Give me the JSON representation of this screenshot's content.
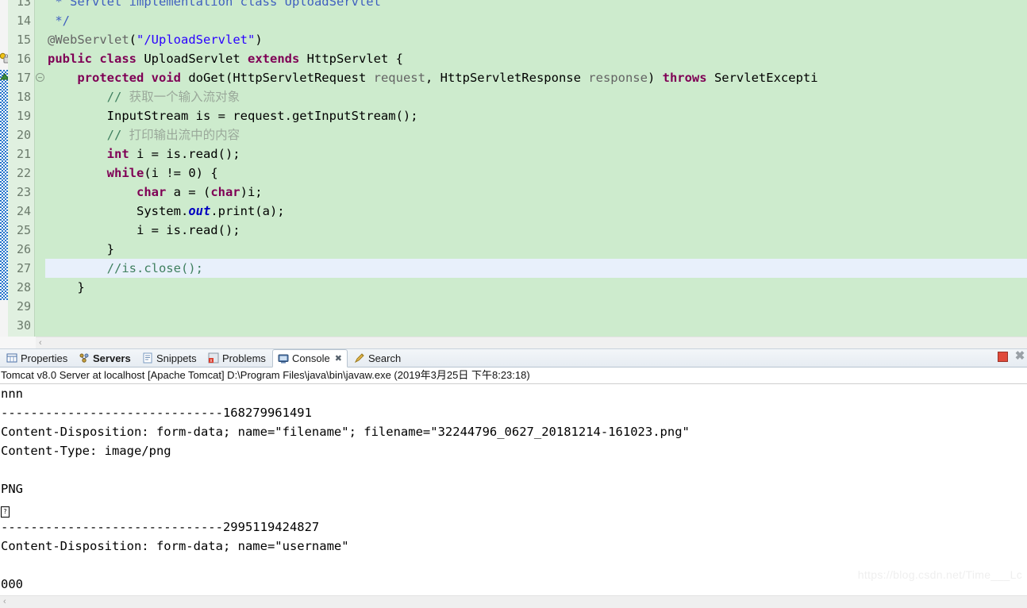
{
  "editor": {
    "first_visible_line": 13,
    "current_line": 27,
    "lines": [
      {
        "num": 13,
        "clipped_top": true,
        "tokens": [
          {
            "t": " * Servlet implementation class UploadServlet",
            "c": "jdoc"
          }
        ]
      },
      {
        "num": 14,
        "tokens": [
          {
            "t": " */",
            "c": "jdoc"
          }
        ]
      },
      {
        "num": 15,
        "tokens": [
          {
            "t": "@WebServlet",
            "c": "anno"
          },
          {
            "t": "(",
            "c": "plain"
          },
          {
            "t": "\"/UploadServlet\"",
            "c": "str"
          },
          {
            "t": ")",
            "c": "plain"
          }
        ]
      },
      {
        "num": 16,
        "gutter_icon": "warning-key-icon",
        "tokens": [
          {
            "t": "public",
            "c": "kw"
          },
          {
            "t": " ",
            "c": "plain"
          },
          {
            "t": "class",
            "c": "kw"
          },
          {
            "t": " UploadServlet ",
            "c": "plain"
          },
          {
            "t": "extends",
            "c": "kw"
          },
          {
            "t": " HttpServlet {",
            "c": "plain"
          }
        ]
      },
      {
        "num": 17,
        "fold": true,
        "gutter_icon": "collapse-triangle-icon",
        "tokens": [
          {
            "t": "    ",
            "c": "plain"
          },
          {
            "t": "protected",
            "c": "kw"
          },
          {
            "t": " ",
            "c": "plain"
          },
          {
            "t": "void",
            "c": "kw"
          },
          {
            "t": " doGet(HttpServletRequest ",
            "c": "plain"
          },
          {
            "t": "request",
            "c": "anno"
          },
          {
            "t": ", HttpServletResponse ",
            "c": "plain"
          },
          {
            "t": "response",
            "c": "anno"
          },
          {
            "t": ") ",
            "c": "plain"
          },
          {
            "t": "throws",
            "c": "kw"
          },
          {
            "t": " ServletExcepti",
            "c": "plain"
          }
        ]
      },
      {
        "num": 18,
        "tokens": [
          {
            "t": "        // ",
            "c": "cmt"
          },
          {
            "t": "获取一个输入流对象",
            "c": "cmt-cn"
          }
        ]
      },
      {
        "num": 19,
        "tokens": [
          {
            "t": "        InputStream is = request.getInputStream();",
            "c": "plain"
          }
        ]
      },
      {
        "num": 20,
        "tokens": [
          {
            "t": "        // ",
            "c": "cmt"
          },
          {
            "t": "打印输出流中的内容",
            "c": "cmt-cn"
          }
        ]
      },
      {
        "num": 21,
        "tokens": [
          {
            "t": "        ",
            "c": "plain"
          },
          {
            "t": "int",
            "c": "kw"
          },
          {
            "t": " i = is.read();",
            "c": "plain"
          }
        ]
      },
      {
        "num": 22,
        "tokens": [
          {
            "t": "        ",
            "c": "plain"
          },
          {
            "t": "while",
            "c": "kw"
          },
          {
            "t": "(i != 0) {",
            "c": "plain"
          }
        ]
      },
      {
        "num": 23,
        "tokens": [
          {
            "t": "            ",
            "c": "plain"
          },
          {
            "t": "char",
            "c": "kw"
          },
          {
            "t": " a = (",
            "c": "plain"
          },
          {
            "t": "char",
            "c": "kw"
          },
          {
            "t": ")i;",
            "c": "plain"
          }
        ]
      },
      {
        "num": 24,
        "tokens": [
          {
            "t": "            System.",
            "c": "plain"
          },
          {
            "t": "out",
            "c": "sfield"
          },
          {
            "t": ".print(a);",
            "c": "plain"
          }
        ]
      },
      {
        "num": 25,
        "tokens": [
          {
            "t": "            i = is.read();",
            "c": "plain"
          }
        ]
      },
      {
        "num": 26,
        "tokens": [
          {
            "t": "        }",
            "c": "plain"
          }
        ]
      },
      {
        "num": 27,
        "current": true,
        "tokens": [
          {
            "t": "        //is.close();",
            "c": "cmt"
          }
        ]
      },
      {
        "num": 28,
        "tokens": [
          {
            "t": "    }",
            "c": "plain"
          }
        ]
      },
      {
        "num": 29,
        "tokens": [
          {
            "t": "",
            "c": "plain"
          }
        ]
      },
      {
        "num": 30,
        "tokens": [
          {
            "t": "",
            "c": "plain"
          }
        ]
      }
    ]
  },
  "bottom_panel": {
    "tabs": [
      {
        "label": "Properties",
        "icon": "properties-icon",
        "active": false,
        "bold": false,
        "closeable": false
      },
      {
        "label": "Servers",
        "icon": "servers-icon",
        "active": false,
        "bold": true,
        "closeable": false
      },
      {
        "label": "Snippets",
        "icon": "snippets-icon",
        "active": false,
        "bold": false,
        "closeable": false
      },
      {
        "label": "Problems",
        "icon": "problems-icon",
        "active": false,
        "bold": false,
        "closeable": false
      },
      {
        "label": "Console",
        "icon": "console-icon",
        "active": true,
        "bold": false,
        "closeable": true
      },
      {
        "label": "Search",
        "icon": "search-icon",
        "active": false,
        "bold": false,
        "closeable": false
      }
    ],
    "close_glyph": "✖",
    "tools": [
      {
        "name": "terminate-button",
        "glyph": ""
      },
      {
        "name": "remove-launch-button",
        "glyph": "✖"
      }
    ],
    "console_header": "Tomcat v8.0 Server at localhost [Apache Tomcat] D:\\Program Files\\java\\bin\\javaw.exe (2019年3月25日 下午8:23:18)",
    "console_lines": [
      {
        "text": "nnn"
      },
      {
        "text": "------------------------------168279961491"
      },
      {
        "text": "Content-Disposition: form-data; name=\"filename\"; filename=\"32244796_0627_20181214-161023.png\""
      },
      {
        "text": "Content-Type: image/png"
      },
      {
        "text": ""
      },
      {
        "text": "PNG"
      },
      {
        "text": "",
        "glyph": "?"
      },
      {
        "text": "------------------------------2995119424827"
      },
      {
        "text": "Content-Disposition: form-data; name=\"username\""
      },
      {
        "text": ""
      },
      {
        "text": "000",
        "clipped_bottom": true
      }
    ],
    "watermark": "https://blog.csdn.net/Time___Lc",
    "scroll_arrow": "‹"
  },
  "colors": {
    "editor_background": "#CDEBCD",
    "current_line": "#E8F0FB",
    "keyword": "#7F0055",
    "string": "#2A00FF",
    "comment": "#3F7F5F",
    "javadoc": "#3F5FBF",
    "static_field": "#0000C0",
    "change_marker": "#1A6FC9",
    "stop_button": "#E04A3A"
  }
}
